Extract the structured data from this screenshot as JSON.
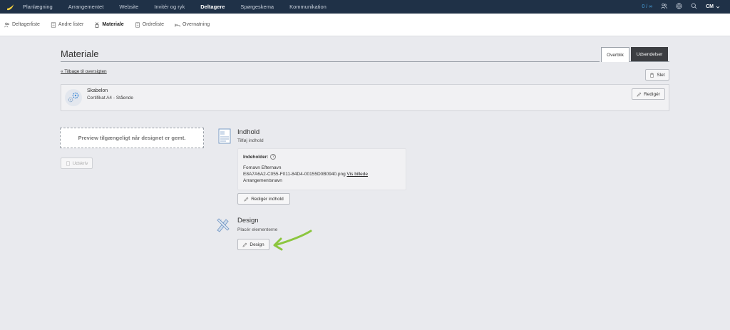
{
  "topnav": {
    "items": [
      {
        "label": "Planlægning",
        "active": false
      },
      {
        "label": "Arrangementet",
        "active": false
      },
      {
        "label": "Website",
        "active": false
      },
      {
        "label": "Invitér og ryk",
        "active": false
      },
      {
        "label": "Deltagere",
        "active": true
      },
      {
        "label": "Spørgeskema",
        "active": false
      },
      {
        "label": "Kommunikation",
        "active": false
      }
    ],
    "counter": "0 / ∞",
    "user_initials": "CM"
  },
  "subnav": {
    "items": [
      {
        "label": "Deltagerliste",
        "icon": "people-icon",
        "active": false
      },
      {
        "label": "Andre lister",
        "icon": "list-icon",
        "active": false
      },
      {
        "label": "Materiale",
        "icon": "lanyard-icon",
        "active": true
      },
      {
        "label": "Ordreliste",
        "icon": "document-icon",
        "active": false
      },
      {
        "label": "Overnatning",
        "icon": "bed-icon",
        "active": false
      }
    ]
  },
  "page": {
    "title": "Materiale",
    "tabs": {
      "overview": "Overblik",
      "sendouts": "Udsendelser"
    },
    "back_link": "« Tilbage til oversigten",
    "delete_label": "Slet"
  },
  "template": {
    "title": "Skabelon",
    "subtitle": "Certifikat A4 - Stående",
    "edit_label": "Redigér"
  },
  "preview": {
    "message": "Preview tilgængeligt når designet er gemt.",
    "print_label": "Udskriv"
  },
  "content_section": {
    "title": "Indhold",
    "subtitle": "Tilføj indhold",
    "contains_label": "Indeholder:",
    "fields": {
      "name": "Fornavn Efternavn",
      "image_file": "E8A7A6A2-C055-F011-84D4-00155D0B0940.png",
      "image_link": "Vis billede",
      "event_name": "Arrangementsnavn"
    },
    "edit_label": "Redigér indhold"
  },
  "design_section": {
    "title": "Design",
    "subtitle": "Placér elementerne",
    "button_label": "Design"
  },
  "colors": {
    "nav_bg": "#1f3147",
    "accent_arrow": "#8cc63f",
    "tab_dark": "#3c3e42"
  }
}
